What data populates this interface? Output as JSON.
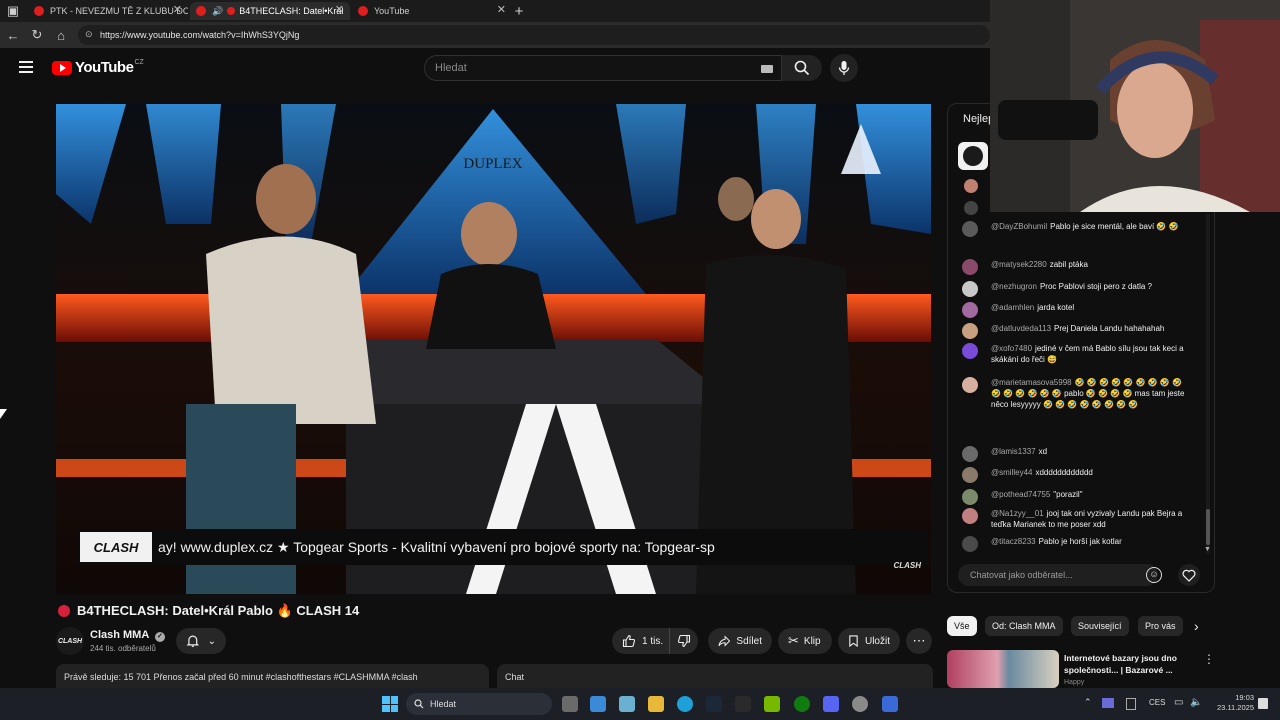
{
  "browser": {
    "tabs": [
      {
        "label": "PTK - NEVEZMU TĚ Z KLUBU DO"
      },
      {
        "label": "B4THECLASH: Datel•Král"
      },
      {
        "label": "YouTube"
      }
    ],
    "url": "https://www.youtube.com/watch?v=IhWhS3YQjNg"
  },
  "header": {
    "logo": "YouTube",
    "country": "CZ",
    "search_placeholder": "Hledat"
  },
  "video": {
    "brand_sign": "DUPLEX",
    "ticker_logo": "CLASH",
    "ticker_text": "ay! www.duplex.cz      ★      Topgear Sports - Kvalitní vybavení pro bojové sporty na: Topgear-sp",
    "corner_logo": "CLASH"
  },
  "details": {
    "title": "B4THECLASH: Datel•Král Pablo 🔥 CLASH 14",
    "channel_name": "Clash MMA",
    "channel_avatar_text": "CLASH",
    "subscribers": "244 tis. odběratelů",
    "like_count": "1 tis.",
    "share_label": "Sdílet",
    "clip_label": "Klip",
    "save_label": "Uložit",
    "info_line": "Právě sleduje: 15 701  Přenos začal před 60 minut  #clashofthestars #CLASHMMA #clash",
    "chat_label": "Chat"
  },
  "chat": {
    "header": "Nejlep",
    "input_placeholder": "Chatovat jako odběratel...",
    "messages": [
      {
        "user": "@DayZBohumil",
        "text": "Pablo je sice mentál, ale baví 🤣 🤣",
        "color": "#5a5a5a"
      },
      {
        "user": "@matysek2280",
        "text": "zabil ptáka",
        "color": "#8a4a6a"
      },
      {
        "user": "@nezhugron",
        "text": "Proc Pablovi stoji pero z datla ?",
        "color": "#c8c8c8"
      },
      {
        "user": "@adamhlen",
        "text": "jarda kotel",
        "color": "#a06aa0"
      },
      {
        "user": "@datluvdeda113",
        "text": "Prej Daniela Landu hahahahah",
        "color": "#c8a080"
      },
      {
        "user": "@xofo7480",
        "text": "jediné v čem má Bablo sílu jsou tak keci a skákání do řeči 😅",
        "color": "#7a4ad8"
      },
      {
        "user": "@marietamasova5998",
        "text": "🤣 🤣 🤣 🤣 🤣 🤣 🤣 🤣 🤣 🤣 🤣 🤣 🤣 🤣 🤣 pablo 🤣 🤣 🤣 🤣 mas tam jeste něco lesyyyyy 🤣 🤣 🤣 🤣 🤣 🤣 🤣 🤣",
        "color": "#d8b0a0"
      },
      {
        "user": "@lamis1337",
        "text": "xd",
        "color": "#6a6a6a"
      },
      {
        "user": "@smilley44",
        "text": "xdddddddddddd",
        "color": "#8a7a6a"
      },
      {
        "user": "@pothead74755",
        "text": "\"porazil\"",
        "color": "#7a8a6a"
      },
      {
        "user": "@Na1zyy__01",
        "text": "jooj tak oni vyzivaly Landu pak Bejra a teďka Marianek to me poser xdd",
        "color": "#c08080"
      },
      {
        "user": "@titacz8233",
        "text": "Pablo je horší jak kotlar",
        "color": "#4a4a4a"
      }
    ]
  },
  "chips": [
    "Vše",
    "Od: Clash MMA",
    "Související",
    "Pro vás"
  ],
  "recommendation": {
    "title": "Internetové bazary jsou dno společnosti... | Bazarové ...",
    "channel": "Happy"
  },
  "taskbar": {
    "search_placeholder": "Hledat",
    "language": "CES",
    "time": "19:03",
    "date": "23.11.2025"
  },
  "colors": {
    "youtube_red": "#ff0000",
    "background": "#0f0f0f",
    "chip_active_bg": "#f1f1f1"
  },
  "icons": {
    "menu": "hamburger-icon",
    "search": "search-icon",
    "mic": "mic-icon",
    "bell": "bell-icon",
    "like": "thumbs-up-icon",
    "dislike": "thumbs-down-icon",
    "share": "share-icon",
    "clip": "scissors-icon",
    "save": "bookmark-icon",
    "more": "more-horizontal-icon",
    "emoji": "emoji-icon",
    "heart": "heart-icon"
  }
}
